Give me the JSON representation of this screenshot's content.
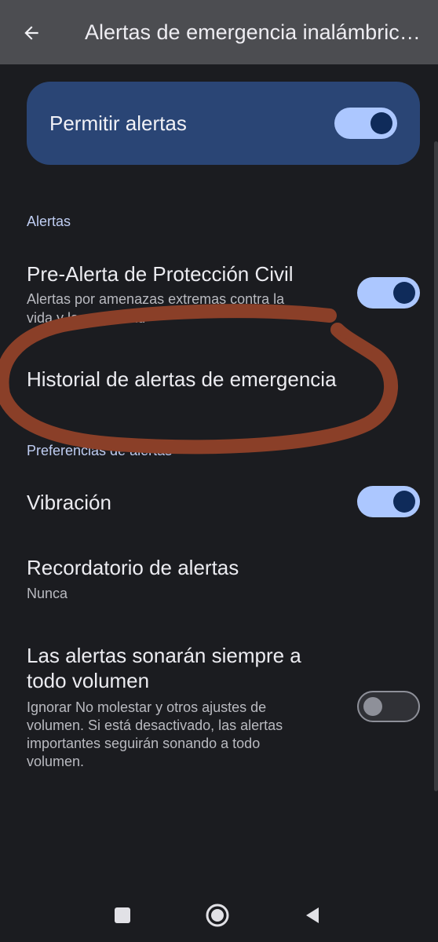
{
  "app_bar": {
    "title": "Alertas de emergencia inalámbric…",
    "back_icon": "arrow-left-icon"
  },
  "master_toggle": {
    "label": "Permitir alertas",
    "enabled": true
  },
  "sections": {
    "alerts": {
      "header": "Alertas",
      "pre_alert": {
        "title": "Pre-Alerta de Protección Civil",
        "subtitle_line1": "Alertas por amenazas extremas contra la",
        "subtitle_line2": "vida y la propiedad",
        "enabled": true
      },
      "history": {
        "title": "Historial de alertas de emergencia"
      }
    },
    "preferences": {
      "header": "Preferencias de alertas",
      "vibration": {
        "title": "Vibración",
        "enabled": true
      },
      "reminder": {
        "title": "Recordatorio de alertas",
        "value": "Nunca"
      },
      "full_volume": {
        "title_line1": "Las alertas sonarán siempre a",
        "title_line2": "todo volumen",
        "subtitle_line1": "Ignorar No molestar y otros ajustes de",
        "subtitle_line2": "volumen. Si está desactivado, las alertas",
        "subtitle_line3": "importantes seguirán sonando a todo",
        "subtitle_line4": "volumen.",
        "enabled": false
      }
    }
  },
  "nav_bar": {
    "recents_icon": "square-icon",
    "home_icon": "circle-icon",
    "back_icon": "triangle-back-icon"
  },
  "colors": {
    "background": "#1b1c20",
    "app_bar": "#4c4d51",
    "card": "#2a4575",
    "toggle_on_track": "#acc7ff",
    "toggle_on_knob": "#0f2b5a",
    "annotation": "#8a3f28"
  }
}
